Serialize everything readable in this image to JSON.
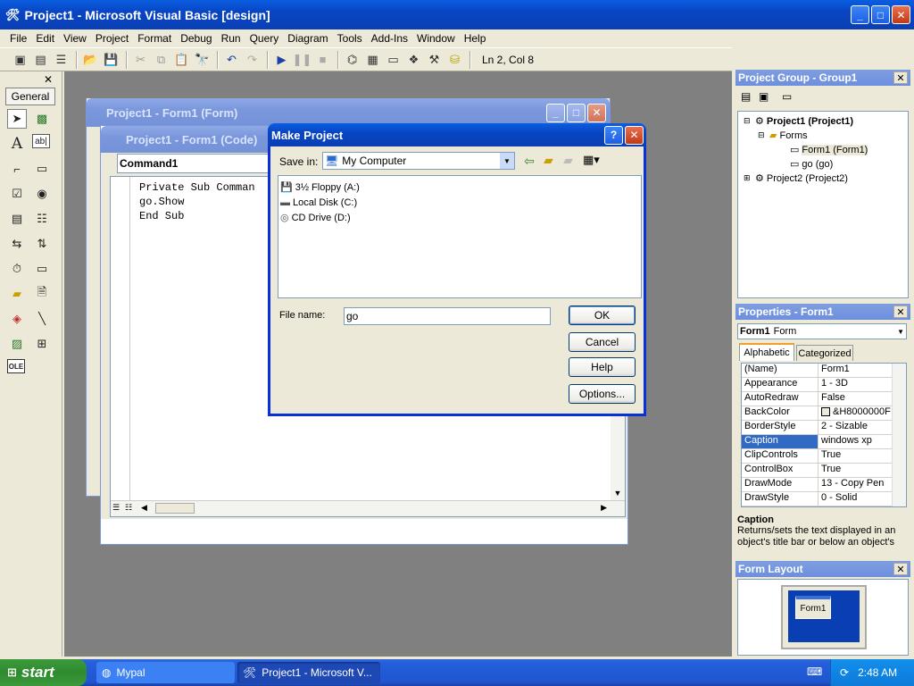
{
  "app": {
    "title": "Project1 - Microsoft Visual Basic [design]"
  },
  "menu": [
    "File",
    "Edit",
    "View",
    "Project",
    "Format",
    "Debug",
    "Run",
    "Query",
    "Diagram",
    "Tools",
    "Add-Ins",
    "Window",
    "Help"
  ],
  "toolbar": {
    "position": "Ln 2, Col 8"
  },
  "toolbox": {
    "tab": "General",
    "tools": [
      "pointer-icon",
      "picturebox-icon",
      "label-icon",
      "textbox-icon",
      "frame-icon",
      "commandbutton-icon",
      "checkbox-icon",
      "optionbutton-icon",
      "combobox-icon",
      "listbox-icon",
      "hscrollbar-icon",
      "vscrollbar-icon",
      "timer-icon",
      "drivelistbox-icon",
      "dirlistbox-icon",
      "filelistbox-icon",
      "shape-icon",
      "line-icon",
      "image-icon",
      "data-icon",
      "ole-icon"
    ],
    "label_glyph": "A",
    "textbox_glyph": "ab|",
    "ole_glyph": "OLE"
  },
  "form_window": {
    "title": "Project1 - Form1 (Form)"
  },
  "code_window": {
    "title": "Project1 - Form1 (Code)",
    "object": "Command1",
    "lines": [
      "Private Sub Comman",
      "go.Show",
      "End Sub"
    ]
  },
  "dialog": {
    "title": "Make Project",
    "save_in_label": "Save in:",
    "save_in_value": "My Computer",
    "items": [
      "3½ Floppy (A:)",
      "Local Disk (C:)",
      "CD Drive (D:)"
    ],
    "file_name_label": "File name:",
    "file_name_value": "go",
    "ok": "OK",
    "cancel": "Cancel",
    "help": "Help",
    "options": "Options..."
  },
  "project_group": {
    "title": "Project Group - Group1",
    "tree": [
      {
        "label": "Project1 (Project1)",
        "bold": true
      },
      {
        "label": "Forms"
      },
      {
        "label": "Form1 (Form1)"
      },
      {
        "label": "go (go)"
      },
      {
        "label": "Project2 (Project2)"
      }
    ]
  },
  "properties": {
    "title": "Properties - Form1",
    "object_name": "Form1",
    "object_type": "Form",
    "tab_alpha": "Alphabetic",
    "tab_cat": "Categorized",
    "rows": [
      {
        "name": "(Name)",
        "value": "Form1"
      },
      {
        "name": "Appearance",
        "value": "1 - 3D"
      },
      {
        "name": "AutoRedraw",
        "value": "False"
      },
      {
        "name": "BackColor",
        "value": "&H8000000F"
      },
      {
        "name": "BorderStyle",
        "value": "2 - Sizable"
      },
      {
        "name": "Caption",
        "value": "windows xp"
      },
      {
        "name": "ClipControls",
        "value": "True"
      },
      {
        "name": "ControlBox",
        "value": "True"
      },
      {
        "name": "DrawMode",
        "value": "13 - Copy Pen"
      },
      {
        "name": "DrawStyle",
        "value": "0 - Solid"
      }
    ],
    "selected": "Caption",
    "desc_title": "Caption",
    "desc_text": "Returns/sets the text displayed in an object's title bar or below an object's"
  },
  "form_layout": {
    "title": "Form Layout",
    "form_label": "Form1"
  },
  "taskbar": {
    "start": "start",
    "tasks": [
      "Mypal",
      "Project1 - Microsoft V..."
    ],
    "clock": "2:48 AM"
  },
  "colors": {
    "accent": "#0a3fb4",
    "desktop": "#808080",
    "selection": "#316ac5"
  }
}
